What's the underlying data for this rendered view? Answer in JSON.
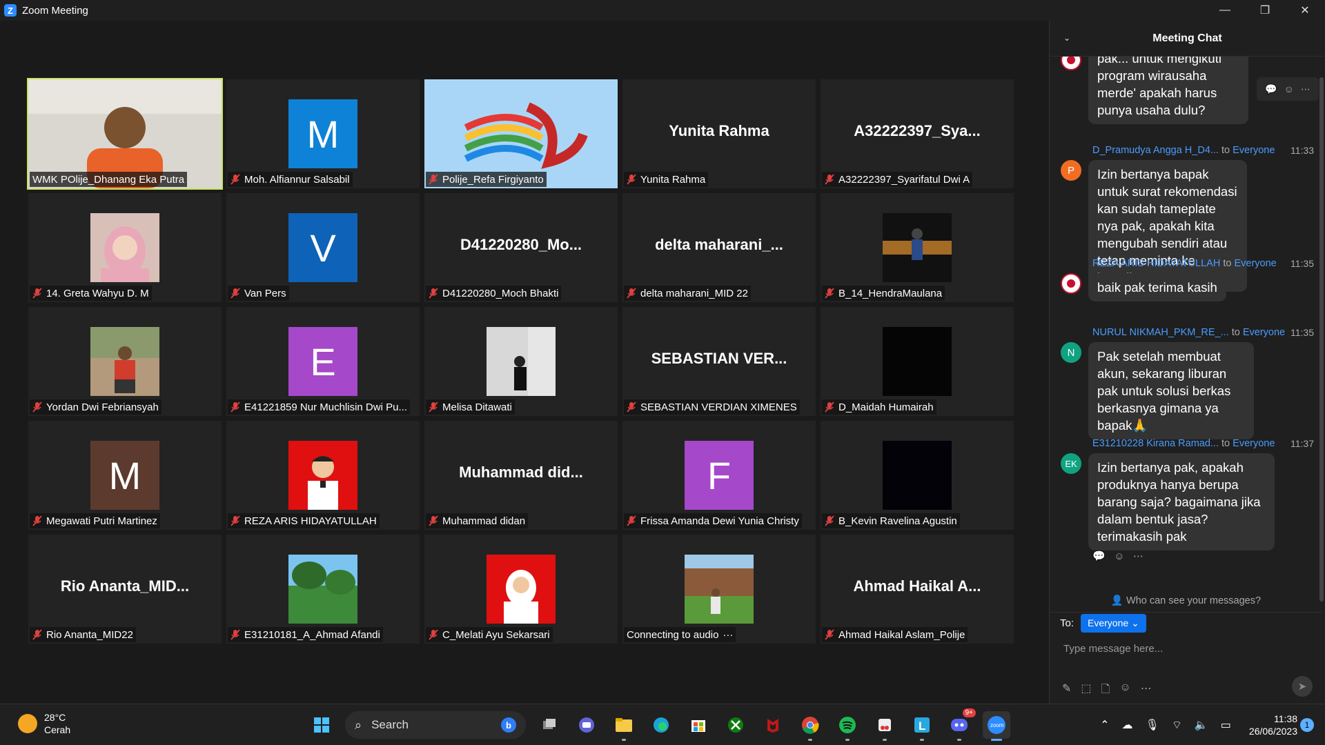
{
  "window": {
    "title": "Zoom Meeting",
    "minimize": "—",
    "restore": "❐",
    "close": "✕"
  },
  "participants": [
    {
      "name": "WMK POlije_Dhanang Eka Putra",
      "display": "photo",
      "muted": false,
      "active": true
    },
    {
      "name": "Moh. Alfiannur Salsabil",
      "display": "letter",
      "letter": "M",
      "color": "#0e82d6",
      "muted": true
    },
    {
      "name": "Polije_Refa Firgiyanto",
      "display": "logo",
      "muted": true
    },
    {
      "name": "Yunita Rahma",
      "display": "text",
      "big": "Yunita Rahma",
      "muted": true
    },
    {
      "name": "A32222397_Syarifatul Dwi A",
      "display": "text",
      "big": "A32222397_Sya...",
      "muted": true
    },
    {
      "name": "14. Greta Wahyu D. M",
      "display": "photo",
      "muted": true
    },
    {
      "name": "Van Pers",
      "display": "letter",
      "letter": "V",
      "color": "#0e62b8",
      "muted": true
    },
    {
      "name": "D41220280_Moch Bhakti",
      "display": "text",
      "big": "D41220280_Mo...",
      "muted": true
    },
    {
      "name": "delta maharani_MID 22",
      "display": "text",
      "big": "delta  maharani_...",
      "muted": true
    },
    {
      "name": "B_14_HendraMaulana",
      "display": "photo",
      "muted": true
    },
    {
      "name": "Yordan Dwi Febriansyah",
      "display": "photo",
      "muted": true
    },
    {
      "name": "E41221859 Nur Muchlisin Dwi Pu...",
      "display": "letter",
      "letter": "E",
      "color": "#a548c9",
      "muted": true
    },
    {
      "name": "Melisa Ditawati",
      "display": "photo",
      "muted": true
    },
    {
      "name": "SEBASTIAN VERDIAN XIMENES",
      "display": "text",
      "big": "SEBASTIAN  VER...",
      "muted": true
    },
    {
      "name": "D_Maidah Humairah",
      "display": "black",
      "muted": true
    },
    {
      "name": "Megawati Putri Martinez",
      "display": "letter",
      "letter": "M",
      "color": "#5d3a2e",
      "muted": true
    },
    {
      "name": "REZA ARIS HIDAYATULLAH",
      "display": "photo",
      "muted": true
    },
    {
      "name": "Muhammad didan",
      "display": "text",
      "big": "Muhammad  did...",
      "muted": true
    },
    {
      "name": "Frissa Amanda Dewi Yunia Christy",
      "display": "letter",
      "letter": "F",
      "color": "#a548c9",
      "muted": true
    },
    {
      "name": "B_Kevin Ravelina Agustin",
      "display": "black",
      "muted": true
    },
    {
      "name": "Rio Ananta_MID22",
      "display": "text",
      "big": "Rio  Ananta_MID...",
      "muted": true
    },
    {
      "name": "E31210181_A_Ahmad Afandi",
      "display": "photo",
      "muted": true
    },
    {
      "name": "C_Melati Ayu Sekarsari",
      "display": "photo",
      "muted": true
    },
    {
      "name": "Connecting to audio",
      "display": "photo",
      "muted": false,
      "extra": "···"
    },
    {
      "name": "Ahmad Haikal Aslam_Polije",
      "display": "text",
      "big": "Ahmad  Haikal  A...",
      "muted": true
    }
  ],
  "chat": {
    "title": "Meeting Chat",
    "messages": [
      {
        "sender": "",
        "to": "",
        "time": "",
        "avatar": "",
        "avatar_color": "#c8102e",
        "text": "pak... untuk mengikuti program wirausaha merde' apakah harus punya usaha dulu?"
      },
      {
        "sender": "D_Pramudya Angga H_D4...",
        "to": "to",
        "toname": "Everyone",
        "time": "11:33",
        "avatar": "P",
        "avatar_color": "#f26d21",
        "text": "Izin bertanya bapak untuk surat rekomendasi kan sudah tameplate nya pak, apakah kita mengubah sendiri atau tetap meminta ke kprodi?"
      },
      {
        "sender": "REZA ARIS HIDAYATULLAH",
        "to": "to",
        "toname": "Everyone",
        "time": "11:35",
        "avatar": "",
        "avatar_color": "#c8102e",
        "text": "baik pak terima kasih"
      },
      {
        "sender": "NURUL NIKMAH_PKM_RE_...",
        "to": "to",
        "toname": "Everyone",
        "time": "11:35",
        "avatar": "N",
        "avatar_color": "#10a37f",
        "text": "Pak setelah membuat akun, sekarang liburan pak untuk solusi berkas berkasnya gimana ya bapak🙏"
      },
      {
        "sender": "E31210228 Kirana Ramad...",
        "to": "to",
        "toname": "Everyone",
        "time": "11:37",
        "avatar": "EK",
        "avatar_color": "#10a37f",
        "text": "Izin bertanya pak, apakah produknya hanya berupa barang saja? bagaimana jika dalam bentuk jasa? terimakasih pak"
      }
    ],
    "who_can_see": "Who can see your messages?",
    "to_label": "To:",
    "to_value": "Everyone",
    "input_placeholder": "Type message here..."
  },
  "taskbar": {
    "temperature": "28°C",
    "weather": "Cerah",
    "search_label": "Search",
    "time": "11:38",
    "date": "26/06/2023",
    "notification_count": "1",
    "discord_badge": "9+"
  }
}
